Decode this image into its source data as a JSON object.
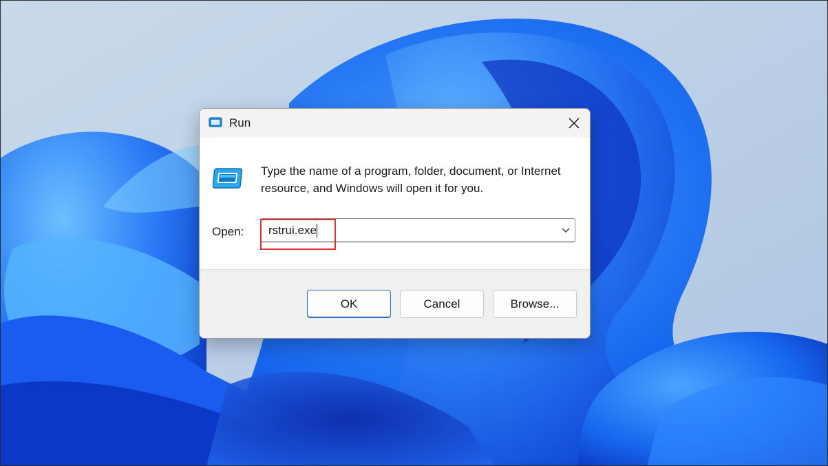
{
  "dialog": {
    "title": "Run",
    "close_icon": "close-icon",
    "description": "Type the name of a program, folder, document, or Internet resource, and Windows will open it for you.",
    "open_label": "Open:",
    "open_value": "rstrui.exe",
    "highlight_color": "#e0312a",
    "buttons": {
      "ok": "OK",
      "cancel": "Cancel",
      "browse": "Browse..."
    }
  },
  "colors": {
    "accent": "#2b6fc4",
    "wallpaper_blue": "#1a5cf0",
    "wallpaper_bg": "#b9cfe6"
  }
}
